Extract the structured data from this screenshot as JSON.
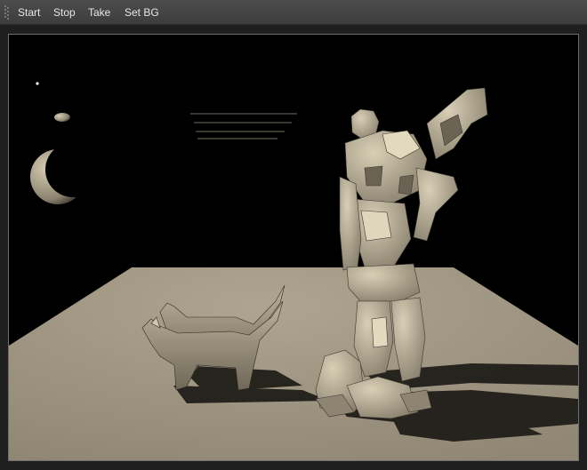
{
  "toolbar": {
    "start_label": "Start",
    "stop_label": "Stop",
    "take_label": "Take",
    "set_bg_label": "Set BG"
  },
  "colors": {
    "toolbar_bg": "#444444",
    "toolbar_text": "#e6e6e6",
    "scene_bg": "#000000",
    "floor": "#a39a86",
    "model_tint": "#c8bea6"
  },
  "viewport": {
    "content": "3D render scene"
  }
}
